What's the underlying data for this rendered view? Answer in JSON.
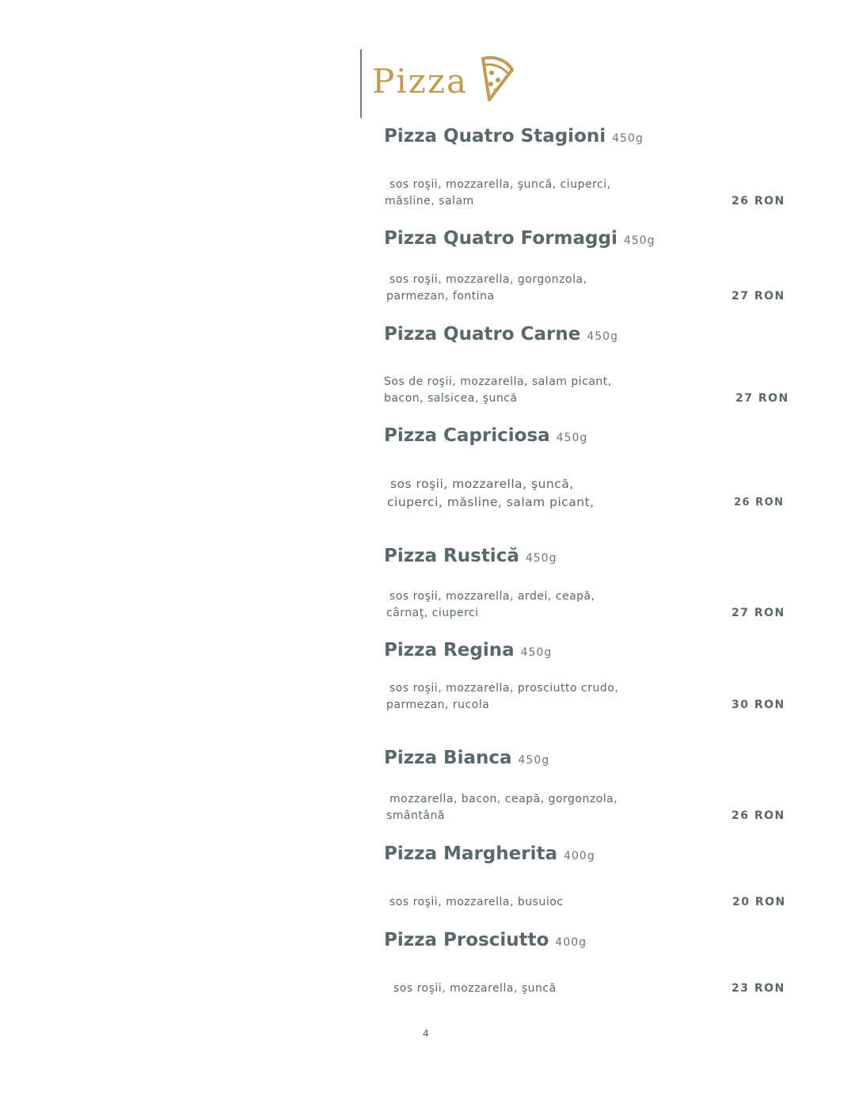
{
  "section": {
    "title": "Pizza",
    "icon": "pizza-slice-icon",
    "accent_color": "#c39a52"
  },
  "items": [
    {
      "name": "Pizza Quatro Stagioni",
      "weight": "450g",
      "desc_line1": "sos roşii, mozzarella, şuncă, ciuperci,",
      "desc_line2": "măsline, salam",
      "price": "26 RON"
    },
    {
      "name": "Pizza Quatro Formaggi",
      "weight": "450g",
      "desc_line1": "sos roşii, mozzarella, gorgonzola,",
      "desc_line2": "parmezan, fontina",
      "price": "27 RON"
    },
    {
      "name": "Pizza Quatro Carne",
      "weight": "450g",
      "desc_line1": "Sos de roşii, mozzarella, salam picant,",
      "desc_line2": "bacon, salsicea, şuncă",
      "price": "27 RON"
    },
    {
      "name": "Pizza Capriciosa",
      "weight": "450g",
      "desc_line1": "sos roşii, mozzarella, şuncă,",
      "desc_line2": "ciuperci, măsline, salam picant,",
      "price": "26 RON"
    },
    {
      "name": "Pizza Rustică",
      "weight": "450g",
      "desc_line1": "sos roşii, mozzarella, ardei, ceapă,",
      "desc_line2": "cârnaţ, ciuperci",
      "price": "27 RON"
    },
    {
      "name": "Pizza Regina",
      "weight": "450g",
      "desc_line1": "sos roşii, mozzarella,  prosciutto crudo,",
      "desc_line2": "parmezan, rucola",
      "price": "30 RON"
    },
    {
      "name": "Pizza Bianca",
      "weight": "450g",
      "desc_line1": "mozzarella, bacon, ceapă, gorgonzola,",
      "desc_line2": "smântână",
      "price": "26 RON"
    },
    {
      "name": "Pizza Margherita",
      "weight": "400g",
      "desc_line1": "sos roşii, mozzarella, busuioc",
      "desc_line2": "",
      "price": "20 RON"
    },
    {
      "name": "Pizza Prosciutto",
      "weight": "400g",
      "desc_line1": "sos roşii,  mozzarella, şuncă",
      "desc_line2": "",
      "price": "23 RON"
    }
  ],
  "page_number": "4"
}
